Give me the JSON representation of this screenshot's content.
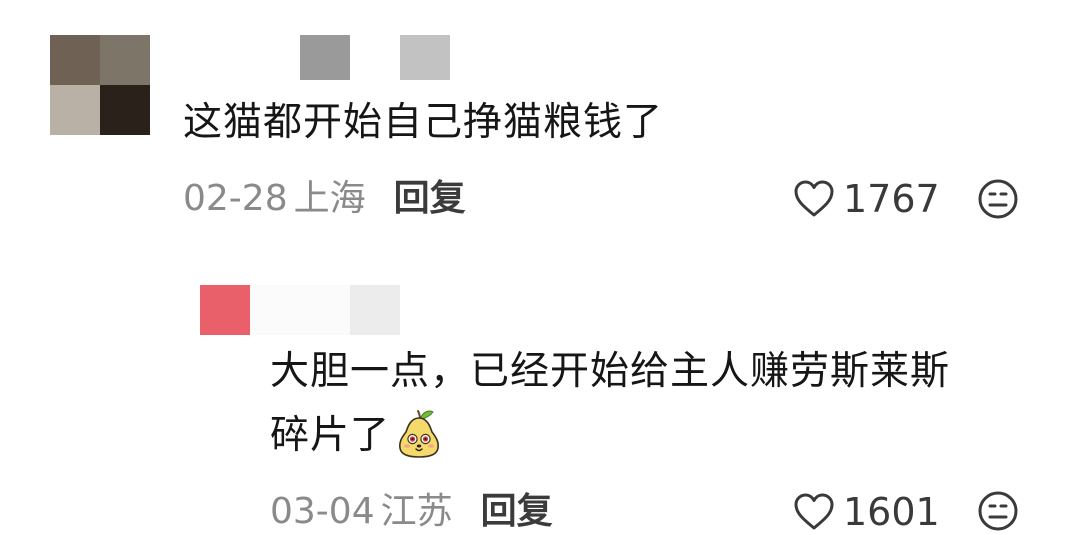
{
  "comments": [
    {
      "text": "这猫都开始自己挣猫粮钱了",
      "date": "02-28",
      "location": "上海",
      "reply_label": "回复",
      "like_count": "1767"
    },
    {
      "text_line1": "大胆一点，已经开始给主人赚劳斯莱斯",
      "text_line2": "碎片了",
      "emoji": "pear-face-emoji",
      "date": "03-04",
      "location": "江苏",
      "reply_label": "回复",
      "like_count": "1601"
    }
  ],
  "icons": {
    "like": "heart-outline-icon",
    "dislike": "meh-face-icon"
  },
  "colors": {
    "text_primary": "#161616",
    "text_meta": "#8a8a8a",
    "reply": "#3b3b3b",
    "reply_avatar": "#e9606a"
  }
}
